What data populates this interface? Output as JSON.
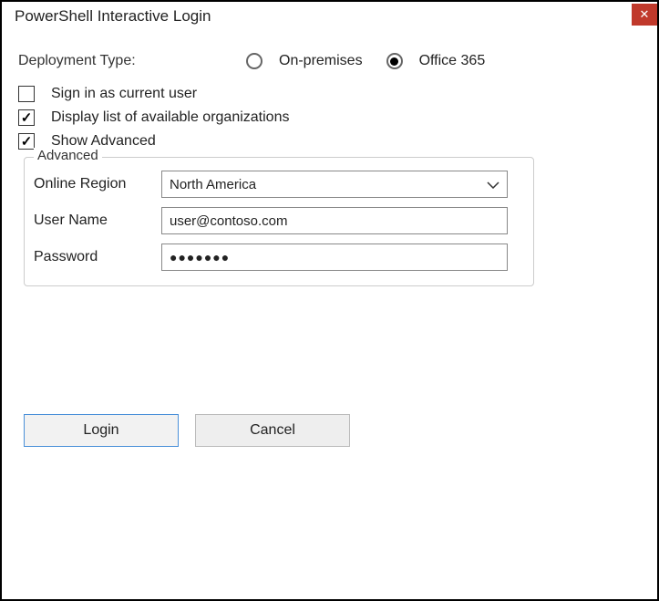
{
  "window": {
    "title": "PowerShell Interactive Login"
  },
  "deployment": {
    "label": "Deployment Type:",
    "options": {
      "onprem": "On-premises",
      "o365": "Office 365"
    },
    "selected": "o365"
  },
  "checks": {
    "sign_in_current": {
      "label": "Sign in as current user",
      "checked": false
    },
    "display_orgs": {
      "label": "Display list of available organizations",
      "checked": true
    },
    "show_advanced": {
      "label": "Show Advanced",
      "checked": true
    }
  },
  "advanced": {
    "legend": "Advanced",
    "region_label": "Online Region",
    "region_value": "North America",
    "username_label": "User Name",
    "username_value": "user@contoso.com",
    "password_label": "Password",
    "password_mask": "●●●●●●●"
  },
  "buttons": {
    "login": "Login",
    "cancel": "Cancel"
  }
}
